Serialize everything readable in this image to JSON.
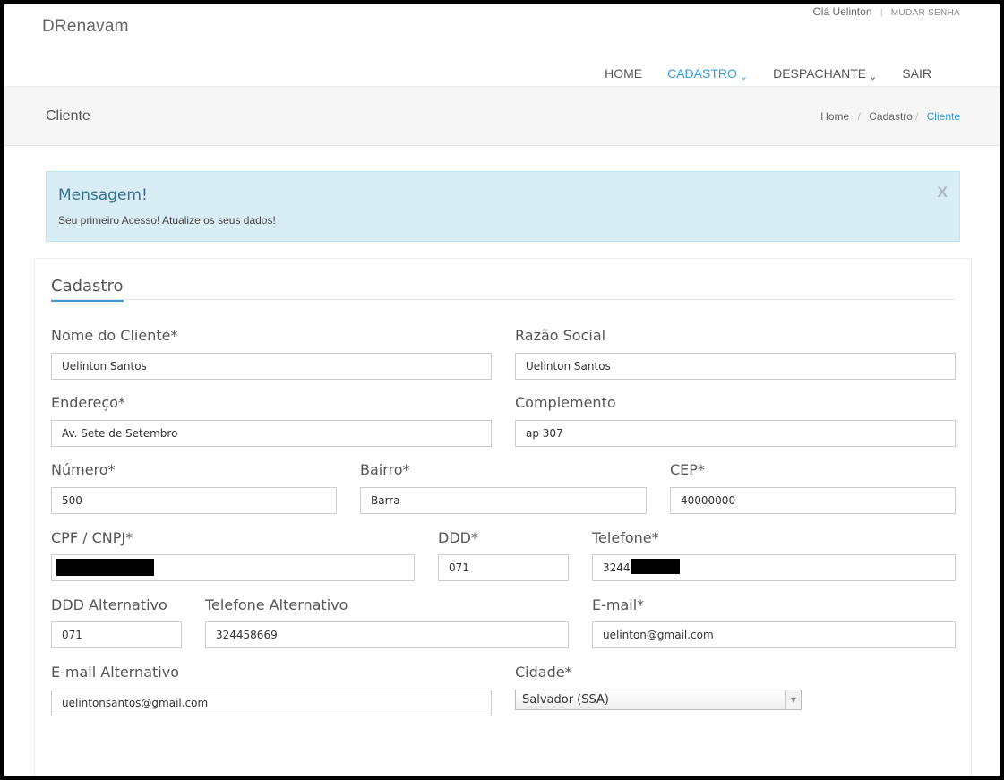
{
  "app": {
    "brand": "DRenavam"
  },
  "user": {
    "greeting": "Olá Uelinton",
    "separator": "|",
    "change_password": "MUDAR SENHA"
  },
  "nav": {
    "items": [
      {
        "label": "HOME",
        "dropdown": false,
        "active": false
      },
      {
        "label": "CADASTRO",
        "dropdown": true,
        "active": true
      },
      {
        "label": "DESPACHANTE",
        "dropdown": true,
        "active": false
      },
      {
        "label": "SAIR",
        "dropdown": false,
        "active": false
      }
    ],
    "caret": "⌄"
  },
  "page": {
    "title": "Cliente",
    "breadcrumb": {
      "home": "Home",
      "section": "Cadastro",
      "current": "Cliente",
      "sep": "/"
    }
  },
  "alert": {
    "title": "Mensagem!",
    "text": "Seu primeiro Acesso! Atualize os seus dados!",
    "close": "X"
  },
  "form": {
    "section_title": "Cadastro",
    "nome": {
      "label": "Nome do Cliente*",
      "value": "Uelinton Santos"
    },
    "razao": {
      "label": "Razão Social",
      "value": "Uelinton Santos"
    },
    "endereco": {
      "label": "Endereço*",
      "value": "Av. Sete de Setembro"
    },
    "complemento": {
      "label": "Complemento",
      "value": "ap 307"
    },
    "numero": {
      "label": "Número*",
      "value": "500"
    },
    "bairro": {
      "label": "Bairro*",
      "value": "Barra"
    },
    "cep": {
      "label": "CEP*",
      "value": "40000000"
    },
    "cpf": {
      "label": "CPF / CNPJ*",
      "value": ""
    },
    "ddd": {
      "label": "DDD*",
      "value": "071"
    },
    "telefone": {
      "label": "Telefone*",
      "value": "3244"
    },
    "ddd_alt": {
      "label": "DDD Alternativo",
      "value": "071"
    },
    "tel_alt": {
      "label": "Telefone Alternativo",
      "value": "324458669"
    },
    "email": {
      "label": "E-mail*",
      "value": "uelinton@gmail.com"
    },
    "email_alt": {
      "label": "E-mail Alternativo",
      "value": "uelintonsantos@gmail.com"
    },
    "cidade": {
      "label": "Cidade*",
      "value": "Salvador (SSA)",
      "arrow": "▼"
    }
  },
  "colors": {
    "accent": "#3a9bd5",
    "alert_bg": "#d9edf7",
    "alert_title": "#31708f"
  }
}
